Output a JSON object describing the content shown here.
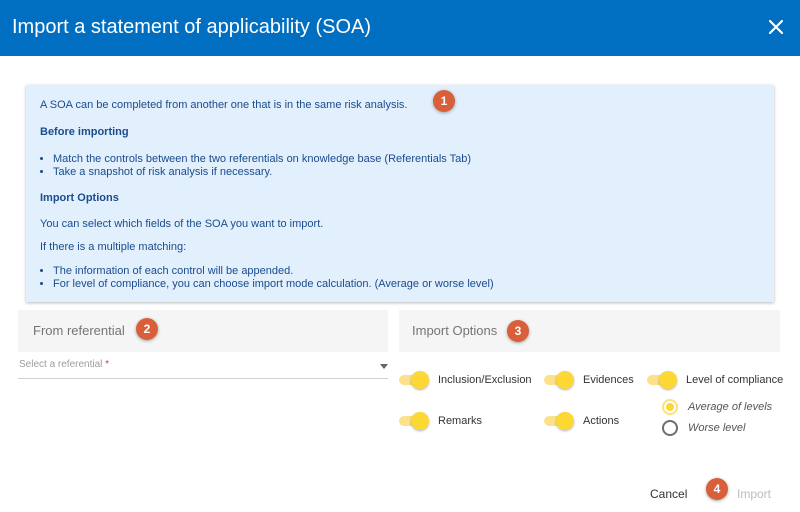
{
  "dialog": {
    "title": "Import a statement of applicability (SOA)",
    "close_icon": "close-icon"
  },
  "info": {
    "intro": "A SOA can be completed from another one that is in the same risk analysis.",
    "before_heading": "Before importing",
    "before_items": [
      "Match the controls between the two referentials on knowledge base (Referentials Tab)",
      "Take a snapshot of risk analysis if necessary."
    ],
    "options_heading": "Import Options",
    "options_text": "You can select which fields of the SOA you want to import.",
    "multiple_text": "If there is a multiple matching:",
    "multiple_items": [
      "The information of each control will be appended.",
      "For level of compliance, you can choose import mode calculation. (Average or worse level)"
    ]
  },
  "badges": [
    "1",
    "2",
    "3",
    "4"
  ],
  "from_referential": {
    "label": "From referential",
    "select_placeholder": "Select a referential",
    "required_mark": "*"
  },
  "import_options": {
    "label": "Import Options",
    "toggles": [
      {
        "label": "Inclusion/Exclusion",
        "on": true
      },
      {
        "label": "Evidences",
        "on": true
      },
      {
        "label": "Level of compliance",
        "on": true
      },
      {
        "label": "Remarks",
        "on": true
      },
      {
        "label": "Actions",
        "on": true
      }
    ],
    "radios": [
      {
        "label": "Average of levels",
        "selected": true
      },
      {
        "label": "Worse level",
        "selected": false
      }
    ]
  },
  "footer": {
    "cancel_label": "Cancel",
    "import_label": "Import"
  },
  "colors": {
    "header": "#006fc1",
    "info_bg": "#e2effc",
    "badge": "#d95f3b",
    "toggle_on": "#fdd835"
  }
}
